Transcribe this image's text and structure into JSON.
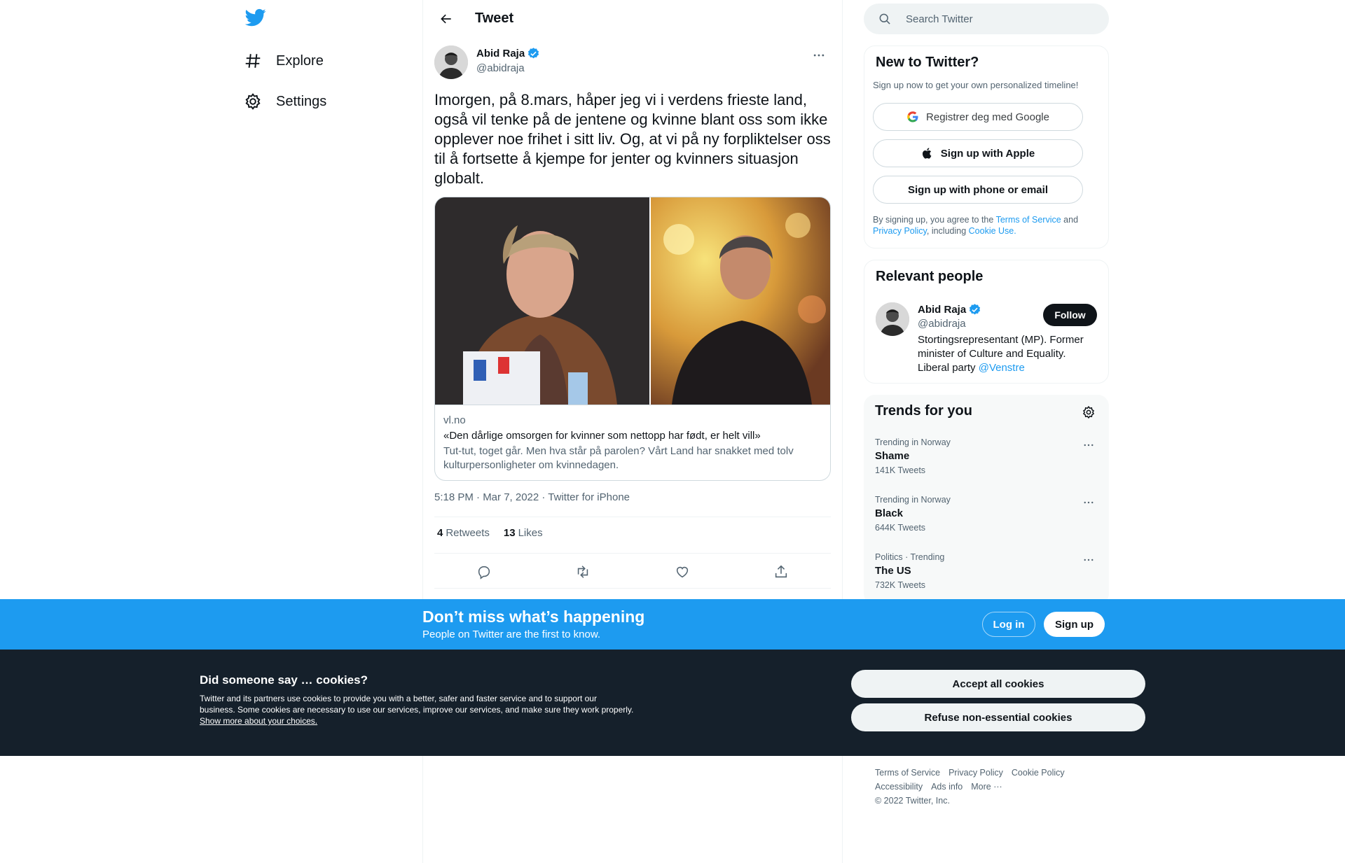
{
  "nav": {
    "logo_icon": "twitter-bird-icon",
    "items": [
      {
        "label": "Explore",
        "icon": "hashtag-icon"
      },
      {
        "label": "Settings",
        "icon": "gear-icon"
      }
    ]
  },
  "header": {
    "title": "Tweet"
  },
  "tweet": {
    "author_name": "Abid Raja",
    "author_handle": "@abidraja",
    "text": "Imorgen, på 8.mars, håper jeg vi i verdens frieste land, også vil tenke på de jentene og kvinne blant oss som ikke opplever noe frihet i sitt liv. Og, at vi på ny forpliktelser oss til å fortsette å kjempe for jenter og kvinners situasjon globalt.",
    "card": {
      "domain": "vl.no",
      "title": "«Den dårlige omsorgen for kvinner som nettopp har født, er helt vill»",
      "description": "Tut-tut, toget går. Men hva står på parolen? Vårt Land har snakket med tolv kulturpersonligheter om kvinnedagen."
    },
    "timestamp": "5:18 PM · Mar 7, 2022 · Twitter for iPhone",
    "retweets_count": "4",
    "retweets_label": "Retweets",
    "likes_count": "13",
    "likes_label": "Likes"
  },
  "search": {
    "placeholder": "Search Twitter"
  },
  "new_to_twitter": {
    "title": "New to Twitter?",
    "subtitle": "Sign up now to get your own personalized timeline!",
    "google_label": "Registrer deg med Google",
    "apple_label": "Sign up with Apple",
    "phone_label": "Sign up with phone or email",
    "legal_1": "By signing up, you agree to the ",
    "legal_tos": "Terms of Service",
    "legal_2": " and ",
    "legal_privacy": "Privacy Policy",
    "legal_3": ", including ",
    "legal_cookie": "Cookie Use."
  },
  "relevant_people": {
    "title": "Relevant people",
    "name": "Abid Raja",
    "handle": "@abidraja",
    "follow_label": "Follow",
    "bio": "Stortingsrepresentant (MP). Former minister of Culture and Equality. Liberal party ",
    "bio_link": "@Venstre"
  },
  "trends": {
    "title": "Trends for you",
    "items": [
      {
        "meta": "Trending in Norway",
        "name": "Shame",
        "count": "141K Tweets"
      },
      {
        "meta": "Trending in Norway",
        "name": "Black",
        "count": "644K Tweets"
      },
      {
        "meta": "Politics · Trending",
        "name": "The US",
        "count": "732K Tweets"
      }
    ]
  },
  "footer": {
    "links_row1": [
      "Terms of Service",
      "Privacy Policy",
      "Cookie Policy"
    ],
    "links_row2": [
      "Accessibility",
      "Ads info",
      "More ···"
    ],
    "copyright": "© 2022 Twitter, Inc."
  },
  "banner": {
    "title": "Don’t miss what’s happening",
    "subtitle": "People on Twitter are the first to know.",
    "login_label": "Log in",
    "signup_label": "Sign up"
  },
  "cookie": {
    "title": "Did someone say … cookies?",
    "body": "Twitter and its partners use cookies to provide you with a better, safer and faster service and to support our business. Some cookies are necessary to use our services, improve our services, and make sure they work properly. ",
    "link": "Show more about your choices.",
    "accept_label": "Accept all cookies",
    "refuse_label": "Refuse non-essential cookies"
  },
  "colors": {
    "accent": "#1d9bf0",
    "text": "#0f1419",
    "muted": "#536471",
    "cookie_bg": "#15202b"
  }
}
